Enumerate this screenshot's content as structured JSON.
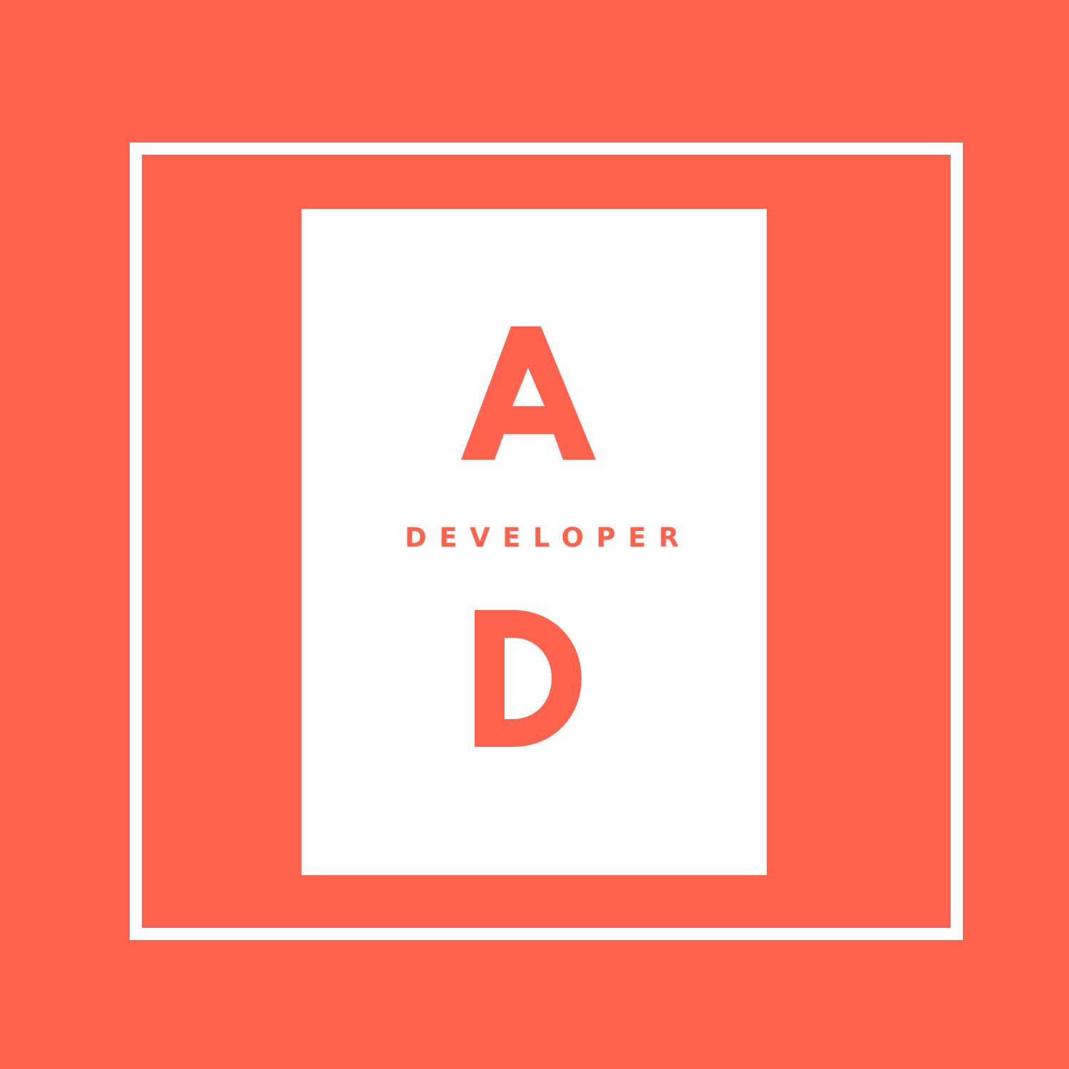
{
  "logo": {
    "subtitle": "DEVELOPER",
    "initials": [
      "A",
      "D"
    ],
    "colors": {
      "background": "#ff634e",
      "panel": "#ffffff",
      "frame": "#ffffff",
      "text": "#ff634e"
    }
  }
}
